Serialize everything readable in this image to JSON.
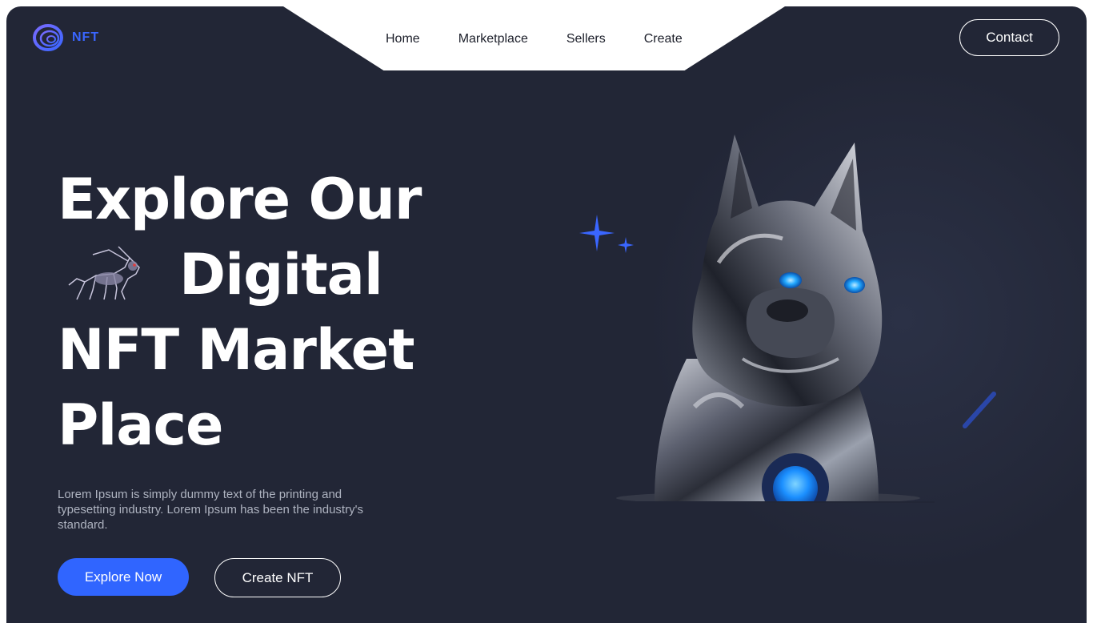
{
  "brand": {
    "logo_text": "NFT",
    "logo_icon": "ring-logo-icon",
    "accent_color": "#3065ff"
  },
  "nav": {
    "items": [
      {
        "label": "Home"
      },
      {
        "label": "Marketplace"
      },
      {
        "label": "Sellers"
      },
      {
        "label": "Create"
      }
    ]
  },
  "header": {
    "contact_label": "Contact"
  },
  "hero": {
    "headline_line1": "Explore Our",
    "headline_line2": "Digital",
    "headline_line3": "NFT Market",
    "headline_line4": "Place",
    "description": "Lorem Ipsum is simply dummy text of the printing and typesetting industry. Lorem Ipsum has been the industry's standard.",
    "primary_button": "Explore Now",
    "secondary_button": "Create NFT",
    "background_color": "#222636"
  }
}
